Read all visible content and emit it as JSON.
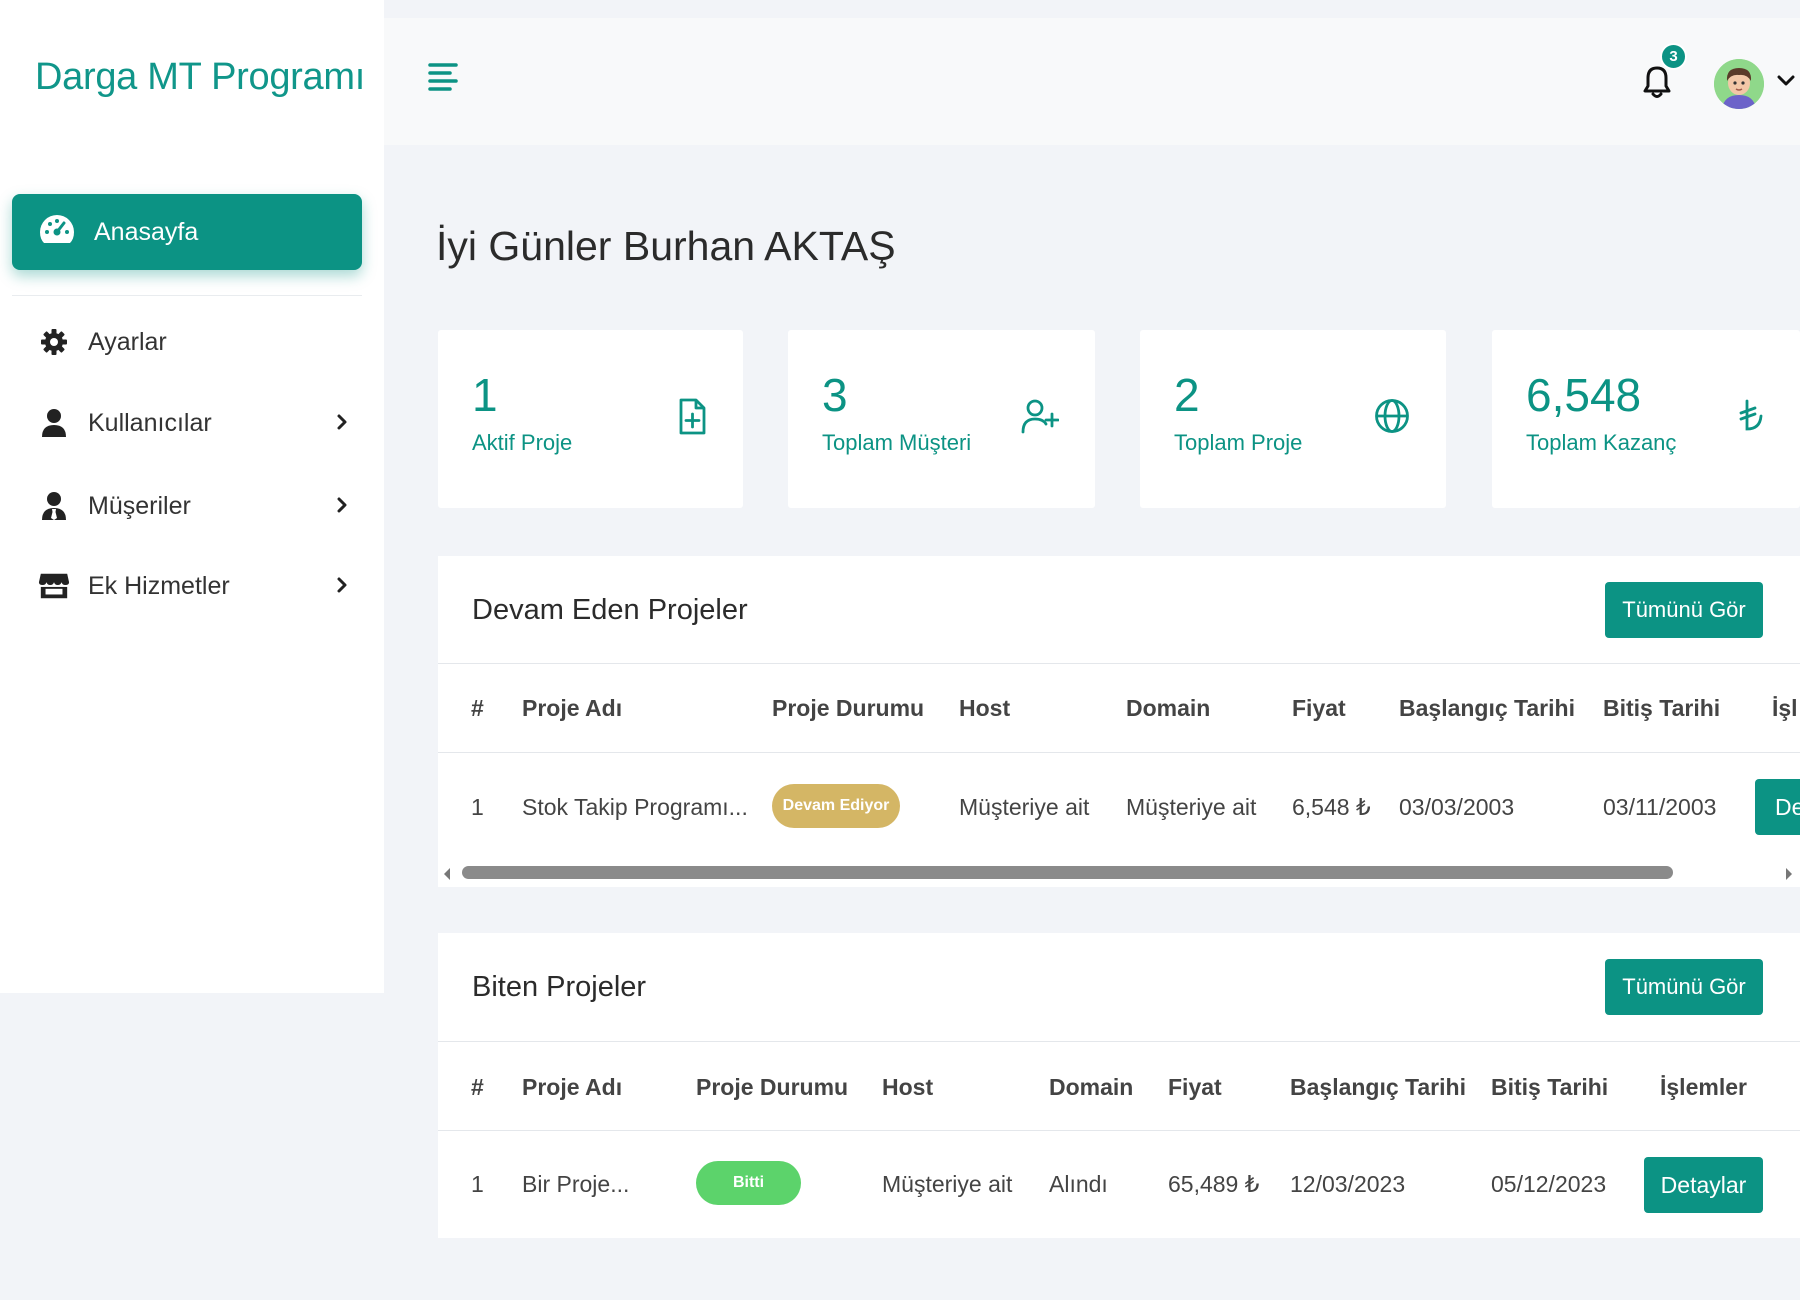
{
  "brand": "Darga MT Programı",
  "sidebar": {
    "active": {
      "label": "Anasayfa",
      "icon": "dashboard-gauge-icon"
    },
    "items": [
      {
        "label": "Ayarlar",
        "icon": "gear-icon",
        "has_submenu": false
      },
      {
        "label": "Kullanıcılar",
        "icon": "user-icon",
        "has_submenu": true
      },
      {
        "label": "Müşeriler",
        "icon": "user-tie-icon",
        "has_submenu": true
      },
      {
        "label": "Ek Hizmetler",
        "icon": "store-icon",
        "has_submenu": true
      }
    ]
  },
  "topbar": {
    "menu_icon": "hamburger-menu-icon",
    "notification_icon": "bell-icon",
    "notification_count": "3",
    "avatar_icon": "user-avatar"
  },
  "greeting": "İyi Günler Burhan AKTAŞ",
  "stats": [
    {
      "value": "1",
      "label": "Aktif Proje",
      "icon": "file-plus-icon"
    },
    {
      "value": "3",
      "label": "Toplam Müşteri",
      "icon": "user-plus-icon"
    },
    {
      "value": "2",
      "label": "Toplam Proje",
      "icon": "globe-icon"
    },
    {
      "value": "6,548",
      "label": "Toplam Kazanç",
      "icon": "lira-icon"
    }
  ],
  "ongoing": {
    "title": "Devam Eden Projeler",
    "button": "Tümünü Gör",
    "headers": [
      "#",
      "Proje Adı",
      "Proje Durumu",
      "Host",
      "Domain",
      "Fiyat",
      "Başlangıç Tarihi",
      "Bitiş Tarihi",
      "İşl"
    ],
    "row": {
      "no": "1",
      "name": "Stok Takip Programı...",
      "status": "Devam Ediyor",
      "host": "Müşteriye ait",
      "domain": "Müşteriye ait",
      "price": "6,548 ₺",
      "start": "03/03/2003",
      "end": "03/11/2003",
      "action": "De"
    },
    "status_color": "#d4b665"
  },
  "finished": {
    "title": "Biten Projeler",
    "button": "Tümünü Gör",
    "headers": [
      "#",
      "Proje Adı",
      "Proje Durumu",
      "Host",
      "Domain",
      "Fiyat",
      "Başlangıç Tarihi",
      "Bitiş Tarihi",
      "İşlemler"
    ],
    "row": {
      "no": "1",
      "name": "Bir Proje...",
      "status": "Bitti",
      "host": "Müşteriye ait",
      "domain": "Alındı",
      "price": "65,489 ₺",
      "start": "12/03/2023",
      "end": "05/12/2023",
      "action": "Detaylar"
    },
    "status_color": "#5cd36b"
  },
  "colors": {
    "accent": "#0c9384",
    "background": "#f2f4f8"
  }
}
